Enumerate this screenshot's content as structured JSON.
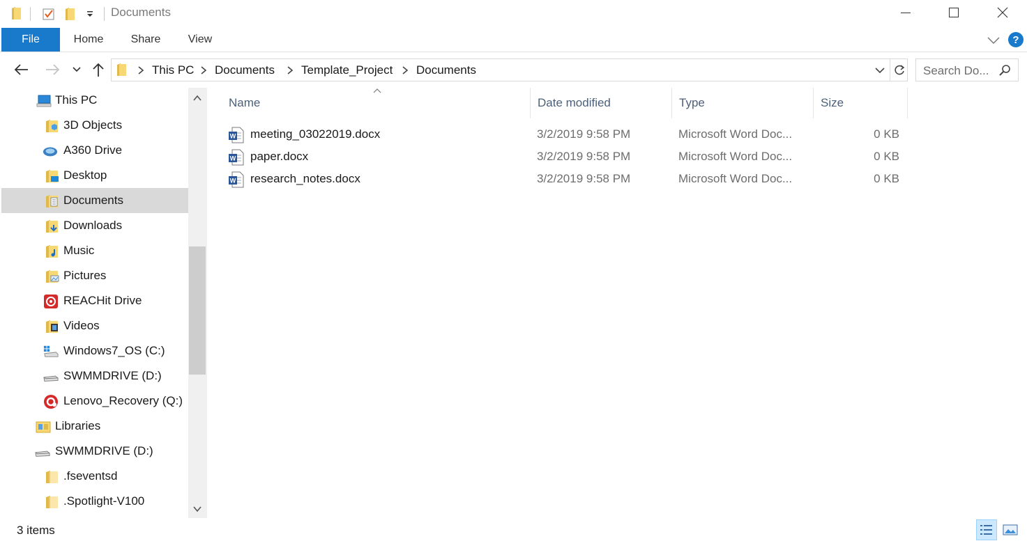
{
  "window": {
    "title": "Documents",
    "controls": [
      "minimize",
      "maximize",
      "close"
    ]
  },
  "ribbon": {
    "tabs": [
      {
        "label": "File",
        "active": true
      },
      {
        "label": "Home"
      },
      {
        "label": "Share"
      },
      {
        "label": "View"
      }
    ],
    "help_label": "?"
  },
  "address": {
    "breadcrumbs": [
      "This PC",
      "Documents",
      "Template_Project",
      "Documents"
    ]
  },
  "search": {
    "placeholder": "Search Do..."
  },
  "nav": {
    "items": [
      {
        "label": "This PC",
        "icon": "pc-icon"
      },
      {
        "label": "3D Objects",
        "icon": "folder-3d-icon"
      },
      {
        "label": "A360 Drive",
        "icon": "a360-drive-icon"
      },
      {
        "label": "Desktop",
        "icon": "desktop-folder-icon"
      },
      {
        "label": "Documents",
        "icon": "documents-folder-icon",
        "selected": true
      },
      {
        "label": "Downloads",
        "icon": "downloads-folder-icon"
      },
      {
        "label": "Music",
        "icon": "music-folder-icon"
      },
      {
        "label": "Pictures",
        "icon": "pictures-folder-icon"
      },
      {
        "label": "REACHit Drive",
        "icon": "reachit-drive-icon"
      },
      {
        "label": "Videos",
        "icon": "videos-folder-icon"
      },
      {
        "label": "Windows7_OS (C:)",
        "icon": "windows-drive-icon"
      },
      {
        "label": "SWMMDRIVE (D:)",
        "icon": "drive-icon"
      },
      {
        "label": "Lenovo_Recovery (Q:)",
        "icon": "recovery-drive-icon"
      },
      {
        "label": "Libraries",
        "icon": "libraries-icon"
      },
      {
        "label": "SWMMDRIVE (D:)",
        "icon": "drive-icon"
      },
      {
        "label": ".fseventsd",
        "icon": "folder-icon"
      },
      {
        "label": ".Spotlight-V100",
        "icon": "folder-icon"
      }
    ]
  },
  "files": {
    "columns": {
      "name": "Name",
      "date": "Date modified",
      "type": "Type",
      "size": "Size"
    },
    "rows": [
      {
        "name": "meeting_03022019.docx",
        "date": "3/2/2019 9:58 PM",
        "type": "Microsoft Word Doc...",
        "size": "0 KB",
        "icon": "word-document-icon"
      },
      {
        "name": "paper.docx",
        "date": "3/2/2019 9:58 PM",
        "type": "Microsoft Word Doc...",
        "size": "0 KB",
        "icon": "word-document-icon"
      },
      {
        "name": "research_notes.docx",
        "date": "3/2/2019 9:58 PM",
        "type": "Microsoft Word Doc...",
        "size": "0 KB",
        "icon": "word-document-icon"
      }
    ]
  },
  "status": {
    "item_count": "3 items"
  },
  "colors": {
    "accent": "#1979ca",
    "folder": "#f8d775",
    "selected_nav": "#d9d9d9",
    "column_header_text": "#4c607a"
  }
}
